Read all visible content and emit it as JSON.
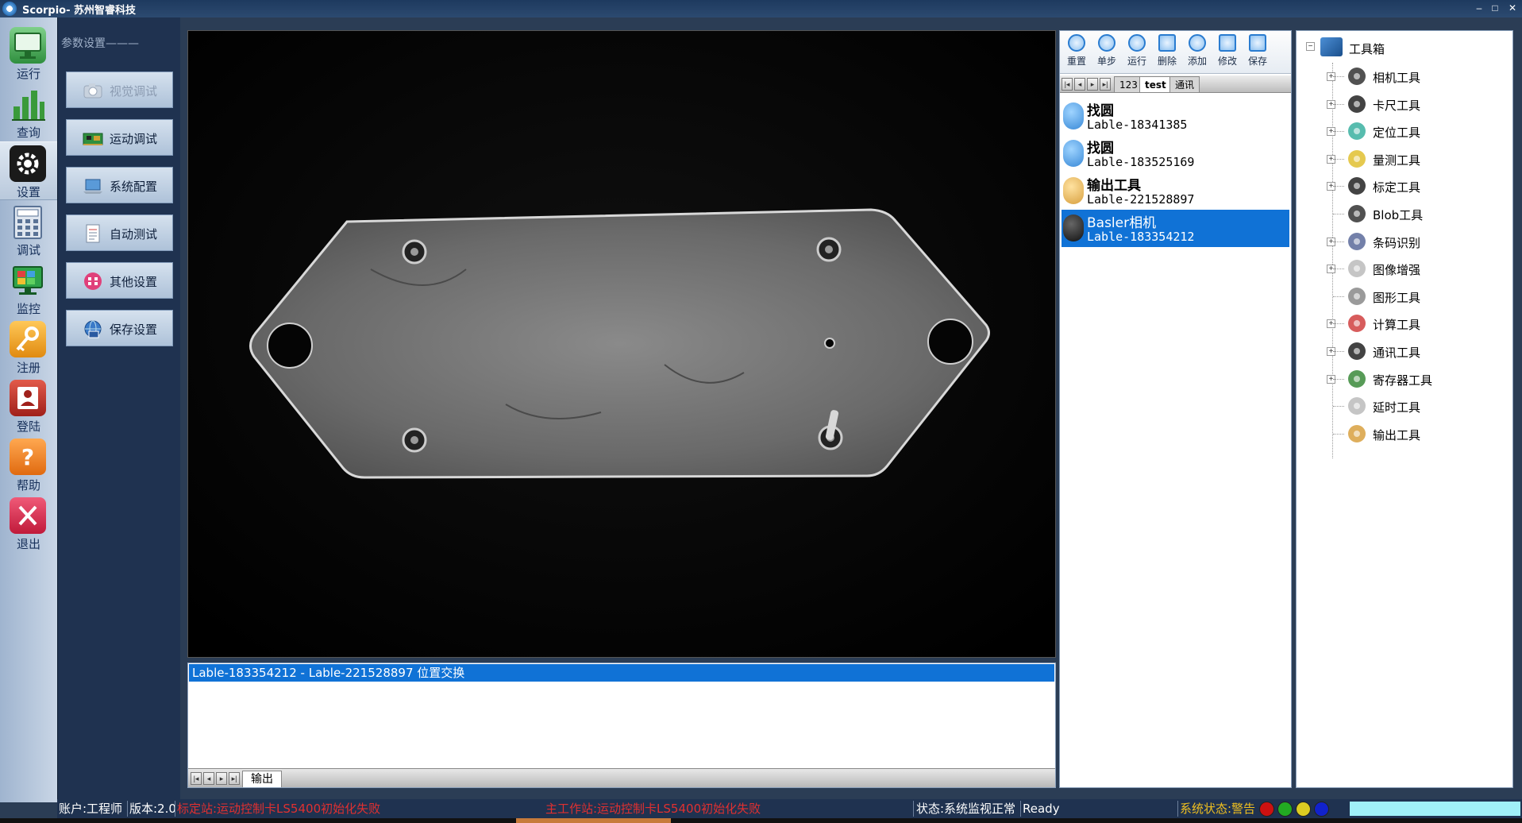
{
  "window": {
    "title": "Scorpio- 苏州智睿科技",
    "controls": [
      "–",
      "□",
      "✕"
    ]
  },
  "nav": {
    "items": [
      {
        "label": "运行",
        "icon": "monitor-icon",
        "color": "#3fa34d"
      },
      {
        "label": "查询",
        "icon": "bar-chart-icon",
        "color": "#3a9a3a"
      },
      {
        "label": "设置",
        "icon": "gear-icon",
        "color": "#222222",
        "active": true
      },
      {
        "label": "调试",
        "icon": "calculator-icon",
        "color": "#6a85a8"
      },
      {
        "label": "监控",
        "icon": "monitor-icon",
        "color": "#2f8f3e"
      },
      {
        "label": "注册",
        "icon": "key-icon",
        "color": "#f0a030"
      },
      {
        "label": "登陆",
        "icon": "login-icon",
        "color": "#c0302a"
      },
      {
        "label": "帮助",
        "icon": "help-icon",
        "color": "#f07c20"
      },
      {
        "label": "退出",
        "icon": "exit-icon",
        "color": "#d03040"
      }
    ]
  },
  "params": {
    "title": "参数设置———",
    "buttons": [
      {
        "label": "视觉调试",
        "icon": "camera-icon",
        "disabled": true
      },
      {
        "label": "运动调试",
        "icon": "circuit-board-icon"
      },
      {
        "label": "系统配置",
        "icon": "laptop-icon"
      },
      {
        "label": "自动测试",
        "icon": "document-icon"
      },
      {
        "label": "其他设置",
        "icon": "settings-icon"
      },
      {
        "label": "保存设置",
        "icon": "save-globe-icon"
      }
    ]
  },
  "log": {
    "selected_line": "Lable-183354212 - Lable-221528897 位置交换",
    "tab": "输出"
  },
  "tasks": {
    "toolbar": [
      "重置",
      "单步",
      "运行",
      "删除",
      "添加",
      "修改",
      "保存"
    ],
    "tabs": [
      "123",
      "test",
      "通讯"
    ],
    "active_tab": "test",
    "items": [
      {
        "name": "找圆",
        "label": "Lable-18341385",
        "icon": "circle-find-icon",
        "selected": false
      },
      {
        "name": "找圆",
        "label": "Lable-183525169",
        "icon": "circle-find-icon",
        "selected": false
      },
      {
        "name": "输出工具",
        "label": "Lable-221528897",
        "icon": "output-icon",
        "selected": false
      },
      {
        "name": "Basler相机",
        "label": "Lable-183354212",
        "icon": "camera-icon",
        "selected": true
      }
    ]
  },
  "toolbox": {
    "root": "工具箱",
    "tools": [
      {
        "label": "相机工具",
        "icon": "camera-icon",
        "expandable": true
      },
      {
        "label": "卡尺工具",
        "icon": "caliper-icon",
        "expandable": true
      },
      {
        "label": "定位工具",
        "icon": "location-icon",
        "expandable": true
      },
      {
        "label": "量测工具",
        "icon": "measure-icon",
        "expandable": true
      },
      {
        "label": "标定工具",
        "icon": "target-icon",
        "expandable": true
      },
      {
        "label": "Blob工具",
        "icon": "blob-icon",
        "expandable": false
      },
      {
        "label": "条码识别",
        "icon": "barcode-scanner-icon",
        "expandable": true
      },
      {
        "label": "图像增强",
        "icon": "image-enhance-icon",
        "expandable": true
      },
      {
        "label": "图形工具",
        "icon": "shape-icon",
        "expandable": false
      },
      {
        "label": "计算工具",
        "icon": "calculator-icon",
        "expandable": true
      },
      {
        "label": "通讯工具",
        "icon": "antenna-icon",
        "expandable": true
      },
      {
        "label": "寄存器工具",
        "icon": "register-icon",
        "expandable": true
      },
      {
        "label": "延时工具",
        "icon": "clock-icon",
        "expandable": false
      },
      {
        "label": "输出工具",
        "icon": "output-icon",
        "expandable": false
      }
    ]
  },
  "status": {
    "account": "账户:工程师",
    "version": "版本:2.0",
    "error1": "标定站:运动控制卡LS5400初始化失败",
    "error2": "主工作站:运动控制卡LS5400初始化失败",
    "state": "状态:系统监视正常",
    "ready": "Ready",
    "system_state": "系统状态:警告",
    "leds": [
      "#cc1111",
      "#22aa22",
      "#ddcc22",
      "#1122cc"
    ]
  }
}
